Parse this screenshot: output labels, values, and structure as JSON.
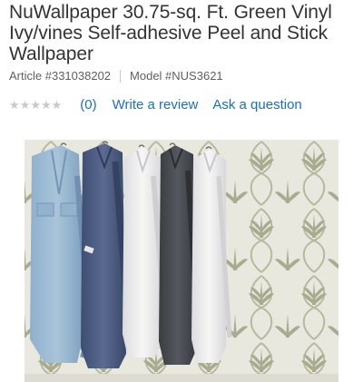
{
  "product": {
    "title": "NuWallpaper 30.75-sq. Ft. Green Vinyl Ivy/vines Self-adhesive Peel and Stick Wallpaper",
    "article": "Article #331038202",
    "model": "Model #NUS3621"
  },
  "rating": {
    "stars": [
      "★",
      "★",
      "★",
      "★",
      "★"
    ],
    "count": "(0)",
    "write_review": "Write a review",
    "ask_question": "Ask a question"
  },
  "image": {
    "description_icon": "product-photo-icon"
  },
  "colors": {
    "link": "#1a6fc4",
    "text": "#333333",
    "muted": "#5f5f5f",
    "star_empty": "#c9c9c9",
    "wallpaper_bg": "#e9e8df",
    "wallpaper_leaf": "#aeb094"
  }
}
